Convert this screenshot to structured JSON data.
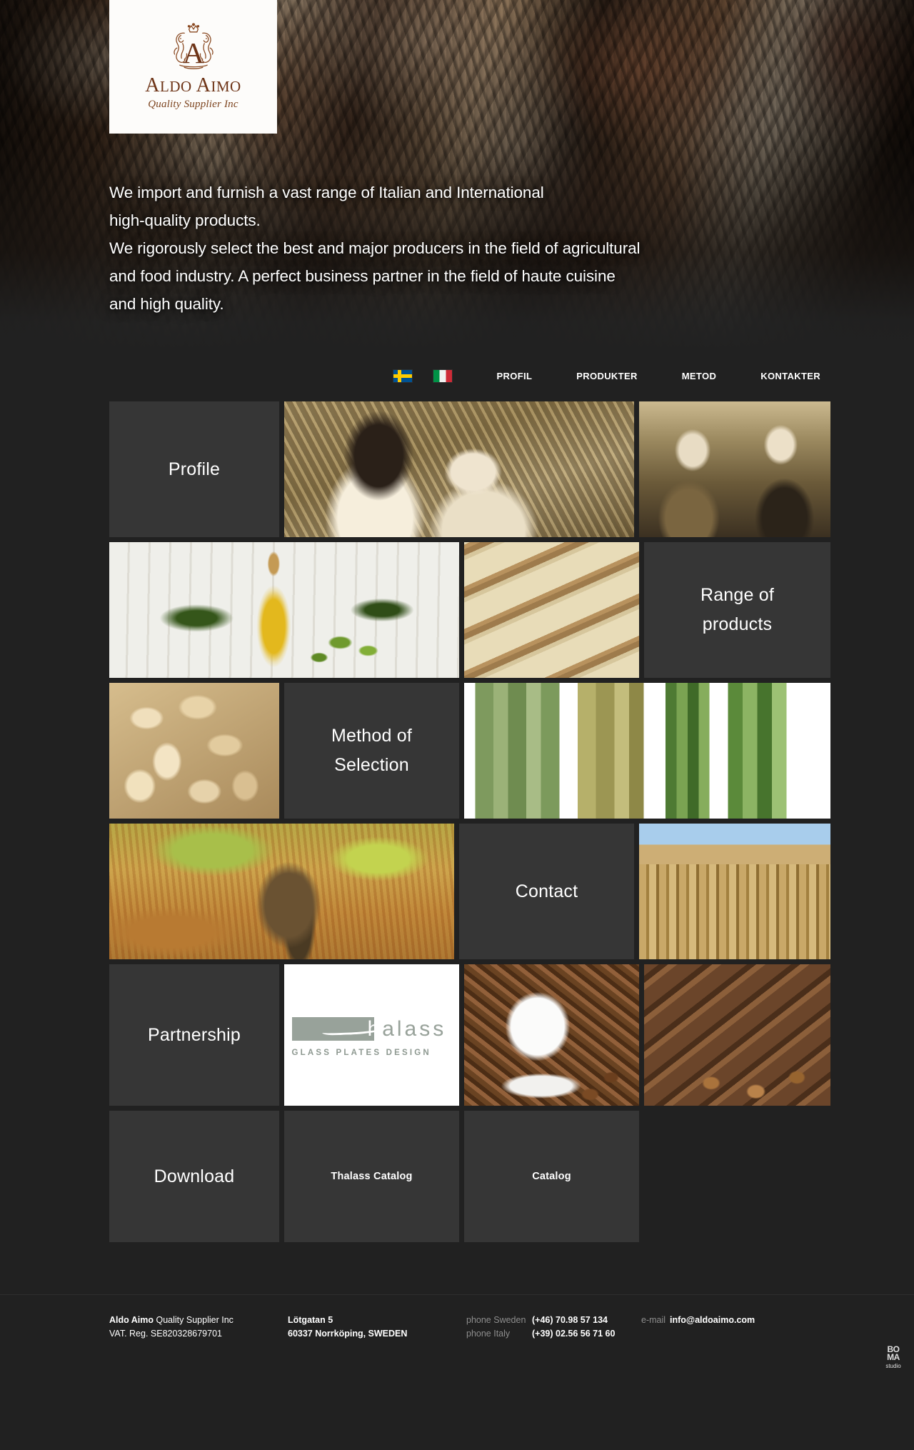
{
  "site": {
    "background_color": "#212121",
    "tile_color": "#363636",
    "accent_color": "#6e3417"
  },
  "hero": {
    "logo": {
      "crest_icon": "lion-crest-icon",
      "name": "ALDO AIMO",
      "name_a": "A",
      "name_rest1": "LDO ",
      "name_a2": "A",
      "name_rest2": "IMO",
      "tagline": "Quality Supplier Inc"
    },
    "paragraphs": [
      "We import and furnish a vast range of Italian and International",
      "high-quality products.",
      "We rigorously select the best and major producers in the field of agricultural",
      "and food industry. A perfect business partner in the field of haute cuisine",
      "and high quality."
    ]
  },
  "nav": {
    "flags": [
      {
        "name": "sweden-flag-icon",
        "label": "Swedish"
      },
      {
        "name": "italy-flag-icon",
        "label": "Italian"
      }
    ],
    "items": [
      {
        "label": "PROFIL"
      },
      {
        "label": "PRODUKTER"
      },
      {
        "label": "METOD"
      },
      {
        "label": "KONTAKTER"
      }
    ]
  },
  "grid": {
    "rows": [
      {
        "cells": [
          {
            "kind": "label",
            "label": "Profile",
            "name": "tile-profile"
          },
          {
            "kind": "photo",
            "photo": "two-men-in-olive-grove-sepia-photo",
            "name": "tile-photo-olive-grove"
          },
          {
            "kind": "photo",
            "photo": "two-men-with-wine-bottles-sepia-photo",
            "name": "tile-photo-wine-tasting"
          }
        ]
      },
      {
        "cells": [
          {
            "kind": "photo",
            "photo": "olive-oil-bottle-photo",
            "name": "tile-photo-olive-oil"
          },
          {
            "kind": "photo",
            "photo": "cheese-wheels-on-shelves-photo",
            "name": "tile-photo-cheese"
          },
          {
            "kind": "label",
            "label": "Range of products",
            "name": "tile-range-of-products"
          }
        ]
      },
      {
        "cells": [
          {
            "kind": "photo",
            "photo": "pine-nuts-photo",
            "name": "tile-photo-pine-nuts"
          },
          {
            "kind": "label",
            "label": "Method of Selection",
            "name": "tile-method-of-selection"
          },
          {
            "kind": "photo",
            "photo": "fresh-herbs-sage-oregano-rosemary-photo",
            "name": "tile-photo-herbs"
          }
        ]
      },
      {
        "cells": [
          {
            "kind": "photo",
            "photo": "ancient-olive-tree-photo",
            "name": "tile-photo-olive-tree"
          },
          {
            "kind": "label",
            "label": "Contact",
            "name": "tile-contact"
          },
          {
            "kind": "photo",
            "photo": "greek-temple-photo",
            "name": "tile-photo-temple"
          }
        ]
      },
      {
        "cells": [
          {
            "kind": "label",
            "label": "Partnership",
            "name": "tile-partnership"
          },
          {
            "kind": "logo",
            "name": "tile-thalass-logo"
          },
          {
            "kind": "photo",
            "photo": "coffee-cup-with-beans-photo",
            "name": "tile-photo-coffee"
          },
          {
            "kind": "photo",
            "photo": "chocolate-and-hazelnuts-photo",
            "name": "tile-photo-chocolate"
          }
        ]
      },
      {
        "cells": [
          {
            "kind": "label",
            "label": "Download",
            "name": "tile-download"
          },
          {
            "kind": "label-small",
            "label": "Thalass Catalog",
            "name": "tile-thalass-catalog"
          },
          {
            "kind": "label-small",
            "label": "Catalog",
            "name": "tile-catalog"
          }
        ]
      }
    ],
    "labels": {
      "profile": "Profile",
      "range_of_products_line1": "Range of",
      "range_of_products_line2": "products",
      "method_line1": "Method of",
      "method_line2": "Selection",
      "contact": "Contact",
      "partnership": "Partnership",
      "download": "Download",
      "thalass_catalog": "Thalass Catalog",
      "catalog": "Catalog"
    }
  },
  "thalass_logo": {
    "word_bold": "h",
    "word_rest": "alass",
    "subtitle": "GLASS PLATES DESIGN"
  },
  "footer": {
    "company_bold": "Aldo Aimo",
    "company_rest": " Quality Supplier Inc",
    "vat": "VAT. Reg. SE820328679701",
    "address_line1": "Lötgatan 5",
    "address_line2": "60337 Norrköping, SWEDEN",
    "phone_sweden_label": "phone Sweden",
    "phone_sweden_value": "(+46) 70.98 57 134",
    "phone_italy_label": "phone Italy",
    "phone_italy_value": "(+39) 02.56 56 71 60",
    "email_label": "e-mail",
    "email_value": "info@aldoaimo.com",
    "credit": {
      "line1": "BO",
      "line2": "MA",
      "line3": "studio"
    }
  }
}
